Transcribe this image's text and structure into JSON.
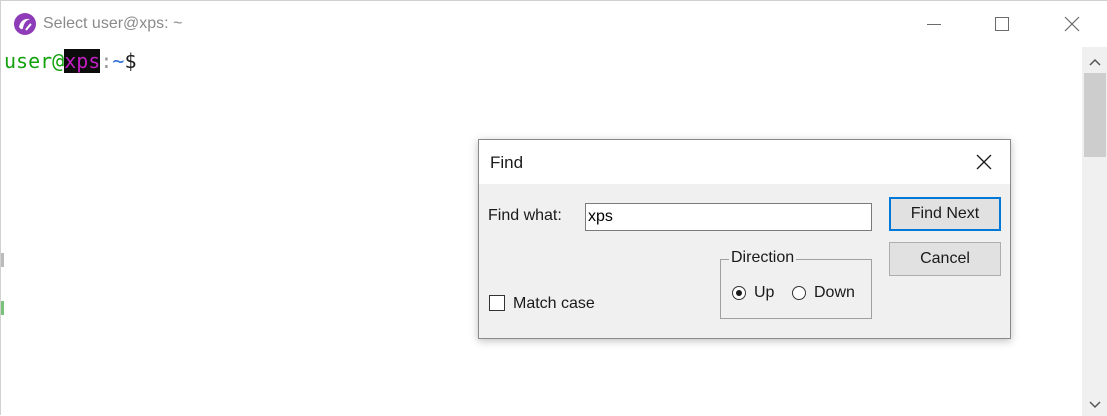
{
  "window": {
    "title": "Select user@xps: ~",
    "icons": {
      "app": "cygwin-app-icon",
      "minimize": "minimize-icon",
      "maximize": "maximize-icon",
      "close": "close-icon"
    }
  },
  "terminal": {
    "prompt_user": "user",
    "prompt_at": "@",
    "prompt_host": "xps",
    "prompt_colon": ":",
    "prompt_path": "~",
    "prompt_symbol": "$"
  },
  "find_dialog": {
    "title": "Find",
    "find_what_label": "Find what:",
    "find_what_value": "xps",
    "find_next_label": "Find Next",
    "cancel_label": "Cancel",
    "match_case_label": "Match case",
    "match_case_checked": false,
    "direction_label": "Direction",
    "up_label": "Up",
    "down_label": "Down",
    "direction_selected": "Up"
  },
  "colors": {
    "prompt_user": "#13a10e",
    "prompt_host": "#c21fc2",
    "prompt_path": "#2b6cd6",
    "highlight_background": "#0c0c0c",
    "default_button_border": "#0078d7"
  }
}
